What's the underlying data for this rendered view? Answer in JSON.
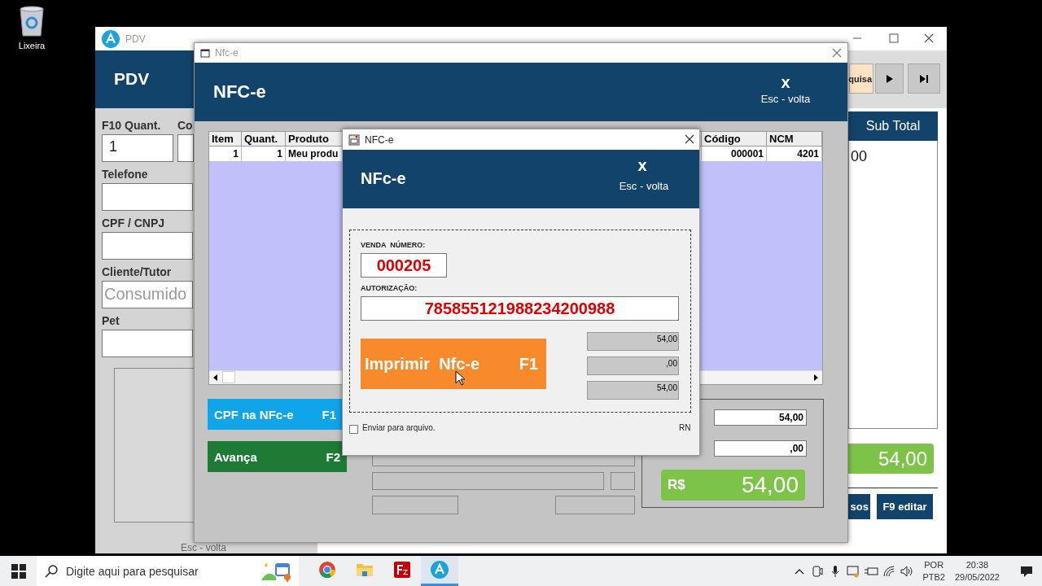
{
  "desktop_icons": [
    {
      "label": "Lixeira"
    }
  ],
  "pdv_window": {
    "title": "PDV",
    "header": "PDV",
    "fields": [
      {
        "label": "F10 Quant.",
        "value": "1"
      },
      {
        "label": "Co"
      },
      {
        "label": "Telefone"
      },
      {
        "label": "CPF / CNPJ"
      },
      {
        "label": "Cliente/Tutor",
        "placeholder": "Consumido"
      },
      {
        "label": "Pet"
      }
    ],
    "search_button": "quisa",
    "subtotal_header": "Sub Total",
    "subtotal_cell": "00",
    "total": "54,00",
    "buttons": [
      "sos",
      "F9 editar"
    ],
    "footer_hint": "Esc - volta"
  },
  "nfce_window": {
    "title": "Nfc-e",
    "header": "NFC-e",
    "close_mark": "x",
    "close_hint": "Esc - volta",
    "table": {
      "columns": [
        "Item",
        "Quant.",
        "Produto",
        "Código",
        "NCM"
      ],
      "rows": [
        [
          "1",
          "1",
          "Meu produ",
          "000001",
          "4201"
        ]
      ]
    },
    "buttons": [
      {
        "label": "CPF na NFc-e",
        "key": "F1",
        "color": "#10a5e8"
      },
      {
        "label": "Avança",
        "key": "F2",
        "color": "#1e7b35"
      }
    ],
    "amounts": [
      "54,00",
      ",00"
    ],
    "total_currency": "R$",
    "total": "54,00"
  },
  "dialog": {
    "title": "NFC-e",
    "header": "NFc-e",
    "close_mark": "x",
    "close_hint": "Esc - volta",
    "sale_label": "VENDA  NÚMERO:",
    "sale_number": "000205",
    "auth_label": "AUTORIZAÇÃO:",
    "auth_number": "785855121988234200988",
    "print_button": {
      "label": "Imprimir  Nfc-e",
      "key": "F1"
    },
    "readouts": [
      "54,00",
      ",00",
      "54,00"
    ],
    "send_to_file": {
      "label": "Enviar para arquivo.",
      "checked": false
    },
    "state": "RN"
  },
  "taskbar": {
    "search_placeholder": "Digite aqui para pesquisar",
    "apps": [
      {
        "kind": "chrome",
        "selected": false
      },
      {
        "kind": "folder",
        "selected": false
      },
      {
        "kind": "filezilla",
        "selected": false
      },
      {
        "kind": "pdv",
        "selected": true
      }
    ],
    "language": [
      "POR",
      "PTB2"
    ],
    "time": "20:38",
    "date": "29/05/2022"
  }
}
